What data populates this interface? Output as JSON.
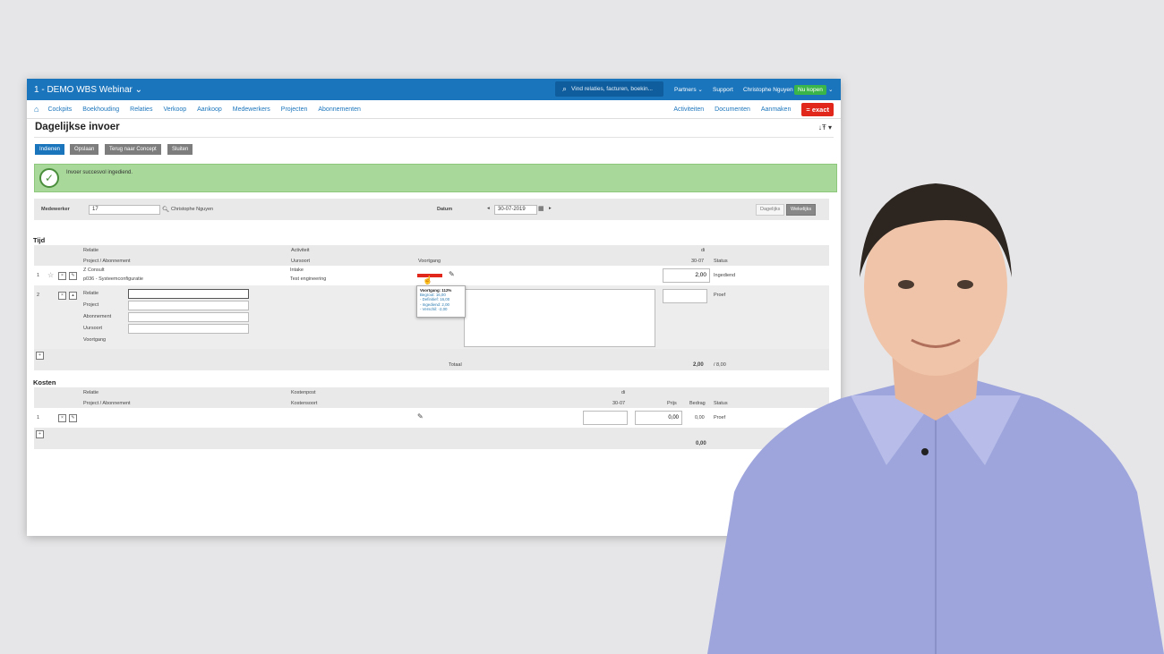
{
  "topbar": {
    "company": "1 - DEMO WBS Webinar",
    "search_placeholder": "Vind relaties, facturen, boekin...",
    "partners": "Partners",
    "support": "Support",
    "user": "Christophe Nguyen",
    "buy": "Nu kopen"
  },
  "nav": {
    "items": [
      "Cockpits",
      "Boekhouding",
      "Relaties",
      "Verkoop",
      "Aankoop",
      "Medewerkers",
      "Projecten",
      "Abonnementen"
    ],
    "right": [
      "Activiteiten",
      "Documenten",
      "Aanmaken"
    ],
    "logo": "exact"
  },
  "page": {
    "title": "Dagelijkse invoer"
  },
  "buttons": {
    "submit": "Indienen",
    "save": "Opslaan",
    "back": "Terug naar Concept",
    "close": "Sluiten"
  },
  "alert": {
    "message": "Invoer succesvol ingediend."
  },
  "filter": {
    "employee_label": "Medewerker",
    "employee_value": "17",
    "employee_name": "Christophe Nguyen",
    "date_label": "Datum",
    "date_value": "30-07-2019",
    "view_daily": "Dagelijks",
    "view_weekly": "Wekelijks"
  },
  "tijd": {
    "heading": "Tijd",
    "col_relatie": "Relatie",
    "col_project": "Project / Abonnement",
    "col_activiteit": "Activiteit",
    "col_uursoort": "Uursoort",
    "col_voortgang": "Voortgang",
    "col_day": "di",
    "col_date": "30-07",
    "col_status": "Status",
    "row1": {
      "num": "1",
      "relatie": "Z Consult",
      "project": "p036 - Systeemconfiguratie",
      "activiteit": "Intake",
      "uursoort": "Test engineering",
      "hours": "2,00",
      "status": "Ingediend"
    },
    "row2": {
      "num": "2",
      "label_relatie": "Relatie",
      "label_project": "Project",
      "label_abonnement": "Abonnement",
      "label_uursoort": "Uursoort",
      "label_voortgang": "Voortgang",
      "status": "Proef"
    },
    "totaal_label": "Totaal",
    "totaal_value": "2,00",
    "totaal_of": "/ 8,00"
  },
  "tooltip": {
    "title": "Voortgang: 112%",
    "begroot": "Begroot: 16,00",
    "definitief": "- Definitief: 16,00",
    "ingediend": "- Ingediend: 2,00",
    "verschil": "- Verschil: -2,00",
    "progress_pct": 112
  },
  "kosten": {
    "heading": "Kosten",
    "col_relatie": "Relatie",
    "col_project": "Project / Abonnement",
    "col_kostenpost": "Kostenpost",
    "col_kostensoort": "Kostensoort",
    "col_day": "di",
    "col_date": "30-07",
    "col_prijs": "Prijs",
    "col_bedrag": "Bedrag",
    "col_status": "Status",
    "row1": {
      "num": "1",
      "prijs": "0,00",
      "bedrag": "0,00",
      "status": "Proef"
    },
    "total": "0,00"
  },
  "colors": {
    "topbar": "#1b75bc",
    "accent": "#1b75bc",
    "success_bg": "#a8d89a",
    "progress_bar": "#e1261c",
    "exact_logo": "#e1261c"
  }
}
